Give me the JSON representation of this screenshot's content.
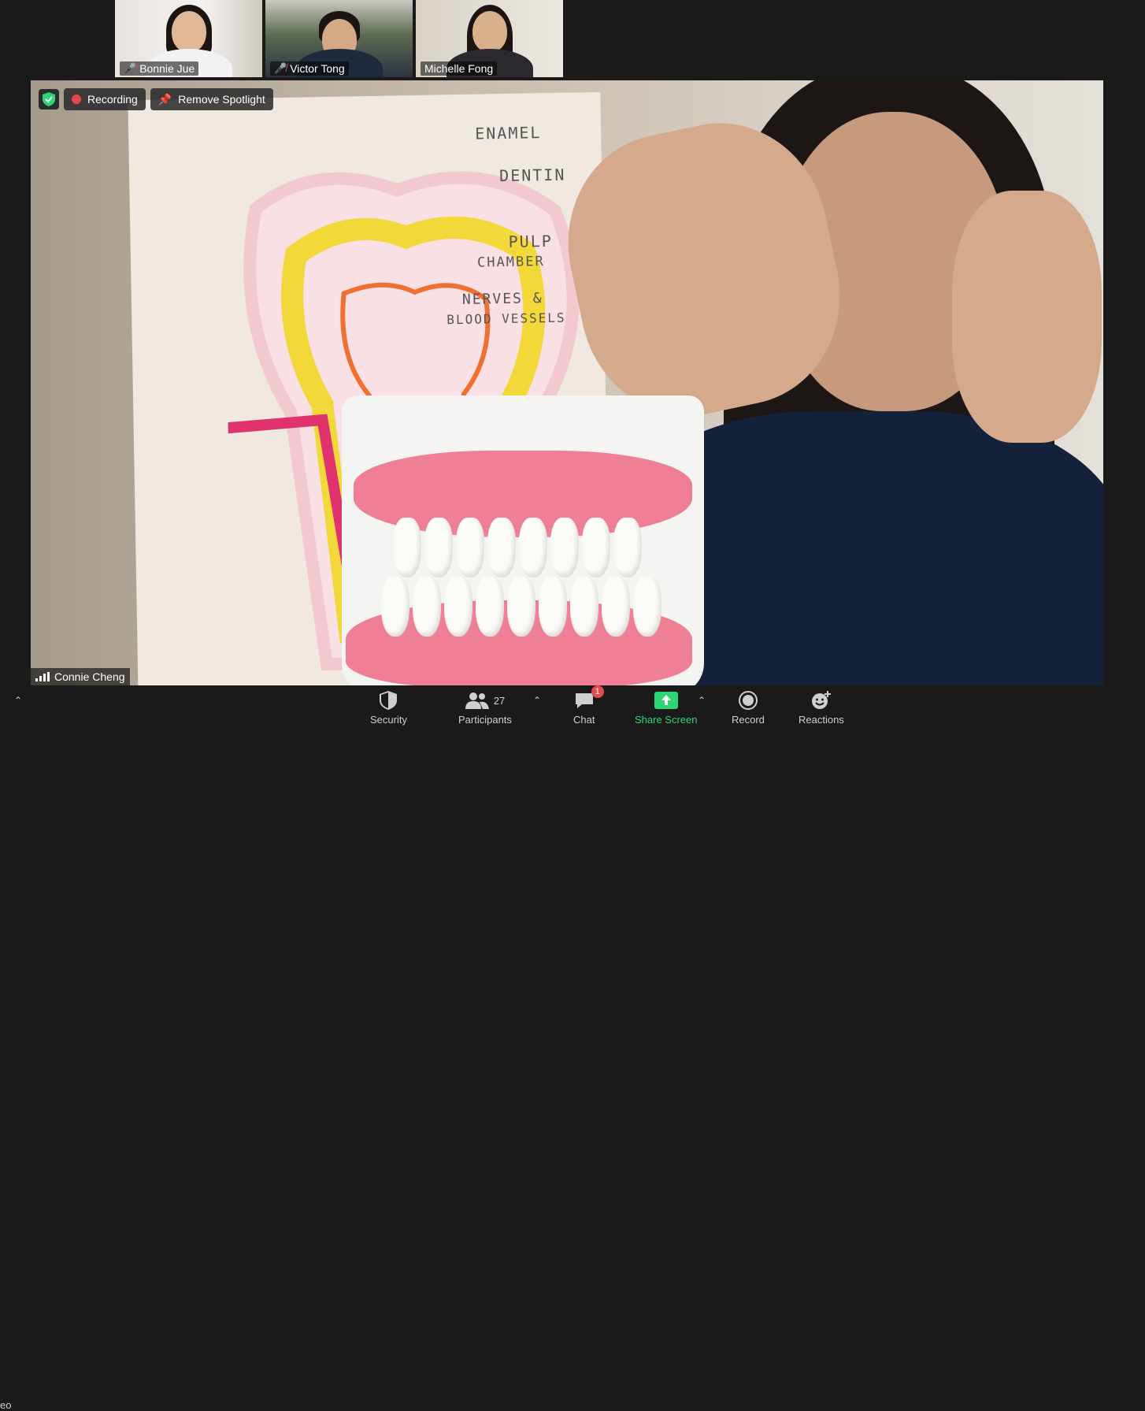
{
  "participants": [
    {
      "name": "Bonnie Jue",
      "muted": true
    },
    {
      "name": "Victor Tong",
      "muted": true
    },
    {
      "name": "Michelle Fong",
      "muted": false
    }
  ],
  "overlay": {
    "recording_label": "Recording",
    "spotlight_label": "Remove Spotlight"
  },
  "speaker": {
    "name": "Connie Cheng"
  },
  "poster_labels": [
    "ENAMEL",
    "DENTIN",
    "PULP",
    "CHAMBER",
    "NERVES &",
    "BLOOD VESSELS"
  ],
  "toolbar": {
    "security": "Security",
    "participants": "Participants",
    "participant_count": "27",
    "chat": "Chat",
    "chat_badge": "1",
    "share": "Share Screen",
    "record": "Record",
    "reactions": "Reactions",
    "edge_label": "eo"
  },
  "colors": {
    "accent_green": "#2ed573",
    "record_red": "#e5484d",
    "toolbar_bg": "#1a1a1a"
  }
}
